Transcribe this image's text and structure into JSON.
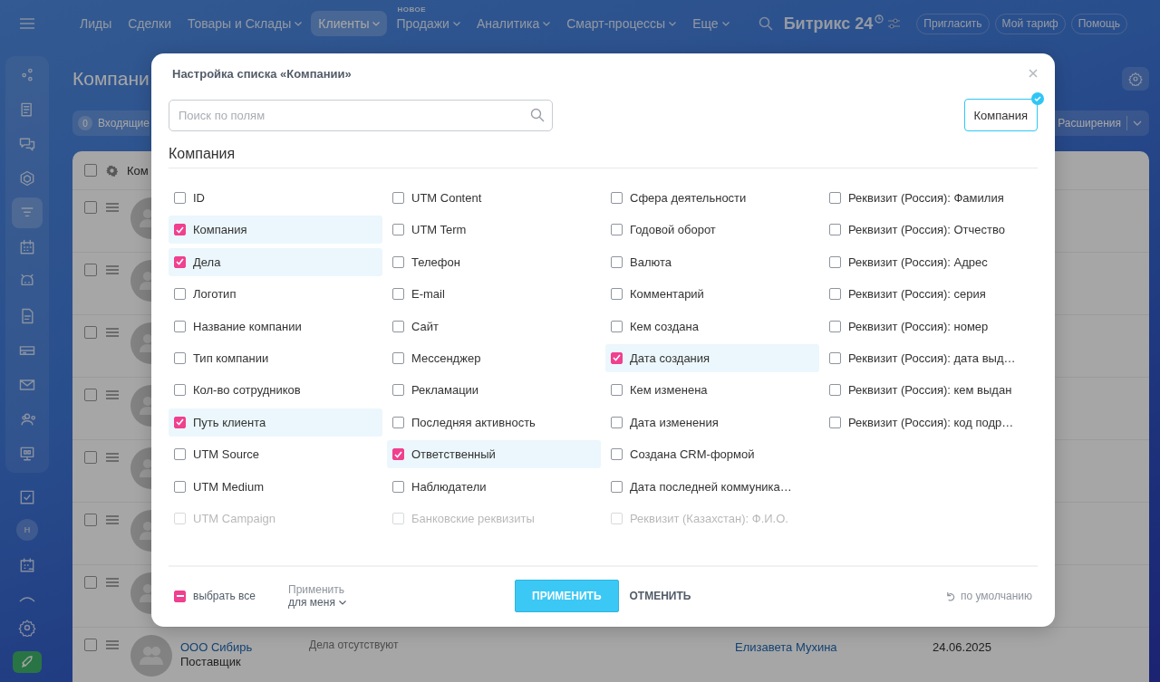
{
  "top_nav": {
    "items": [
      {
        "label": "Лиды",
        "selected": false,
        "dropdown": false
      },
      {
        "label": "Сделки",
        "selected": false,
        "dropdown": false
      },
      {
        "label": "Товары и Склады",
        "selected": false,
        "dropdown": true
      },
      {
        "label": "Клиенты",
        "selected": true,
        "dropdown": true
      },
      {
        "label": "Продажи",
        "selected": false,
        "dropdown": true,
        "badge": "НОВОЕ"
      },
      {
        "label": "Аналитика",
        "selected": false,
        "dropdown": true
      },
      {
        "label": "Смарт-процессы",
        "selected": false,
        "dropdown": true
      },
      {
        "label": "Еще",
        "selected": false,
        "dropdown": true
      }
    ],
    "logo": "Битрикс 24",
    "buttons": [
      "Пригласить",
      "Мой тариф",
      "Помощь"
    ]
  },
  "sidebar": {
    "items": [
      {
        "selected": false
      },
      {
        "selected": false
      },
      {
        "selected": false
      },
      {
        "selected": false
      },
      {
        "selected": true
      },
      {
        "selected": false
      },
      {
        "selected": false
      },
      {
        "selected": false
      },
      {
        "selected": false
      },
      {
        "selected": false
      },
      {
        "selected": false
      },
      {
        "selected": false
      }
    ],
    "avatar_letter": "Н"
  },
  "page": {
    "title": "Компани",
    "filter": {
      "count": "0",
      "label": "Входящие"
    },
    "extensions": "Расширения"
  },
  "table": {
    "all_checked": false,
    "header": "Ком",
    "rows": [
      {
        "checked": false
      },
      {
        "checked": false
      },
      {
        "checked": false
      },
      {
        "checked": false
      },
      {
        "checked": false
      },
      {
        "checked": false
      },
      {
        "checked": false
      },
      {
        "checked": false,
        "name": "ООО Сибирь",
        "type": "Поставщик",
        "activity": "Дела отсутствуют",
        "responsible": "Елизавета Мухина",
        "date": "24.06.2025"
      }
    ]
  },
  "dialog": {
    "title": "Настройка списка «Компании»",
    "search": {
      "placeholder": "Поиск по полям"
    },
    "sections": [
      {
        "label": "Компания",
        "selected": true
      }
    ],
    "heading": "Компания",
    "columns": [
      [
        {
          "label": "ID",
          "checked": false
        },
        {
          "label": "Компания",
          "checked": true
        },
        {
          "label": "Дела",
          "checked": true
        },
        {
          "label": "Логотип",
          "checked": false
        },
        {
          "label": "Название компании",
          "checked": false
        },
        {
          "label": "Тип компании",
          "checked": false
        },
        {
          "label": "Кол-во сотрудников",
          "checked": false
        },
        {
          "label": "Путь клиента",
          "checked": true
        },
        {
          "label": "UTM Source",
          "checked": false
        },
        {
          "label": "UTM Medium",
          "checked": false
        },
        {
          "label": "UTM Campaign",
          "checked": false
        }
      ],
      [
        {
          "label": "UTM Content",
          "checked": false
        },
        {
          "label": "UTM Term",
          "checked": false
        },
        {
          "label": "Телефон",
          "checked": false
        },
        {
          "label": "E-mail",
          "checked": false
        },
        {
          "label": "Сайт",
          "checked": false
        },
        {
          "label": "Мессенджер",
          "checked": false
        },
        {
          "label": "Рекламации",
          "checked": false
        },
        {
          "label": "Последняя активность",
          "checked": false
        },
        {
          "label": "Ответственный",
          "checked": true
        },
        {
          "label": "Наблюдатели",
          "checked": false
        },
        {
          "label": "Банковские реквизиты",
          "checked": false
        }
      ],
      [
        {
          "label": "Сфера деятельности",
          "checked": false
        },
        {
          "label": "Годовой оборот",
          "checked": false
        },
        {
          "label": "Валюта",
          "checked": false
        },
        {
          "label": "Комментарий",
          "checked": false
        },
        {
          "label": "Кем создана",
          "checked": false
        },
        {
          "label": "Дата создания",
          "checked": true
        },
        {
          "label": "Кем изменена",
          "checked": false
        },
        {
          "label": "Дата изменения",
          "checked": false
        },
        {
          "label": "Создана CRM-формой",
          "checked": false
        },
        {
          "label": "Дата последней коммуника…",
          "checked": false
        },
        {
          "label": "Реквизит (Казахстан): Ф.И.О.",
          "checked": false
        }
      ],
      [
        {
          "label": "Реквизит (Россия): Фамилия",
          "checked": false
        },
        {
          "label": "Реквизит (Россия): Отчество",
          "checked": false
        },
        {
          "label": "Реквизит (Россия): Адрес",
          "checked": false
        },
        {
          "label": "Реквизит (Россия): серия",
          "checked": false
        },
        {
          "label": "Реквизит (Россия): номер",
          "checked": false
        },
        {
          "label": "Реквизит (Россия): дата выд…",
          "checked": false
        },
        {
          "label": "Реквизит (Россия): кем выдан",
          "checked": false
        },
        {
          "label": "Реквизит (Россия): код подр…",
          "checked": false
        }
      ]
    ],
    "select_all": {
      "label": "выбрать все",
      "indeterminate": true
    },
    "apply_scope": {
      "label": "Применить",
      "value": "для меня"
    },
    "apply": "ПРИМЕНИТЬ",
    "cancel": "ОТМЕНИТЬ",
    "reset": "по умолчанию"
  }
}
